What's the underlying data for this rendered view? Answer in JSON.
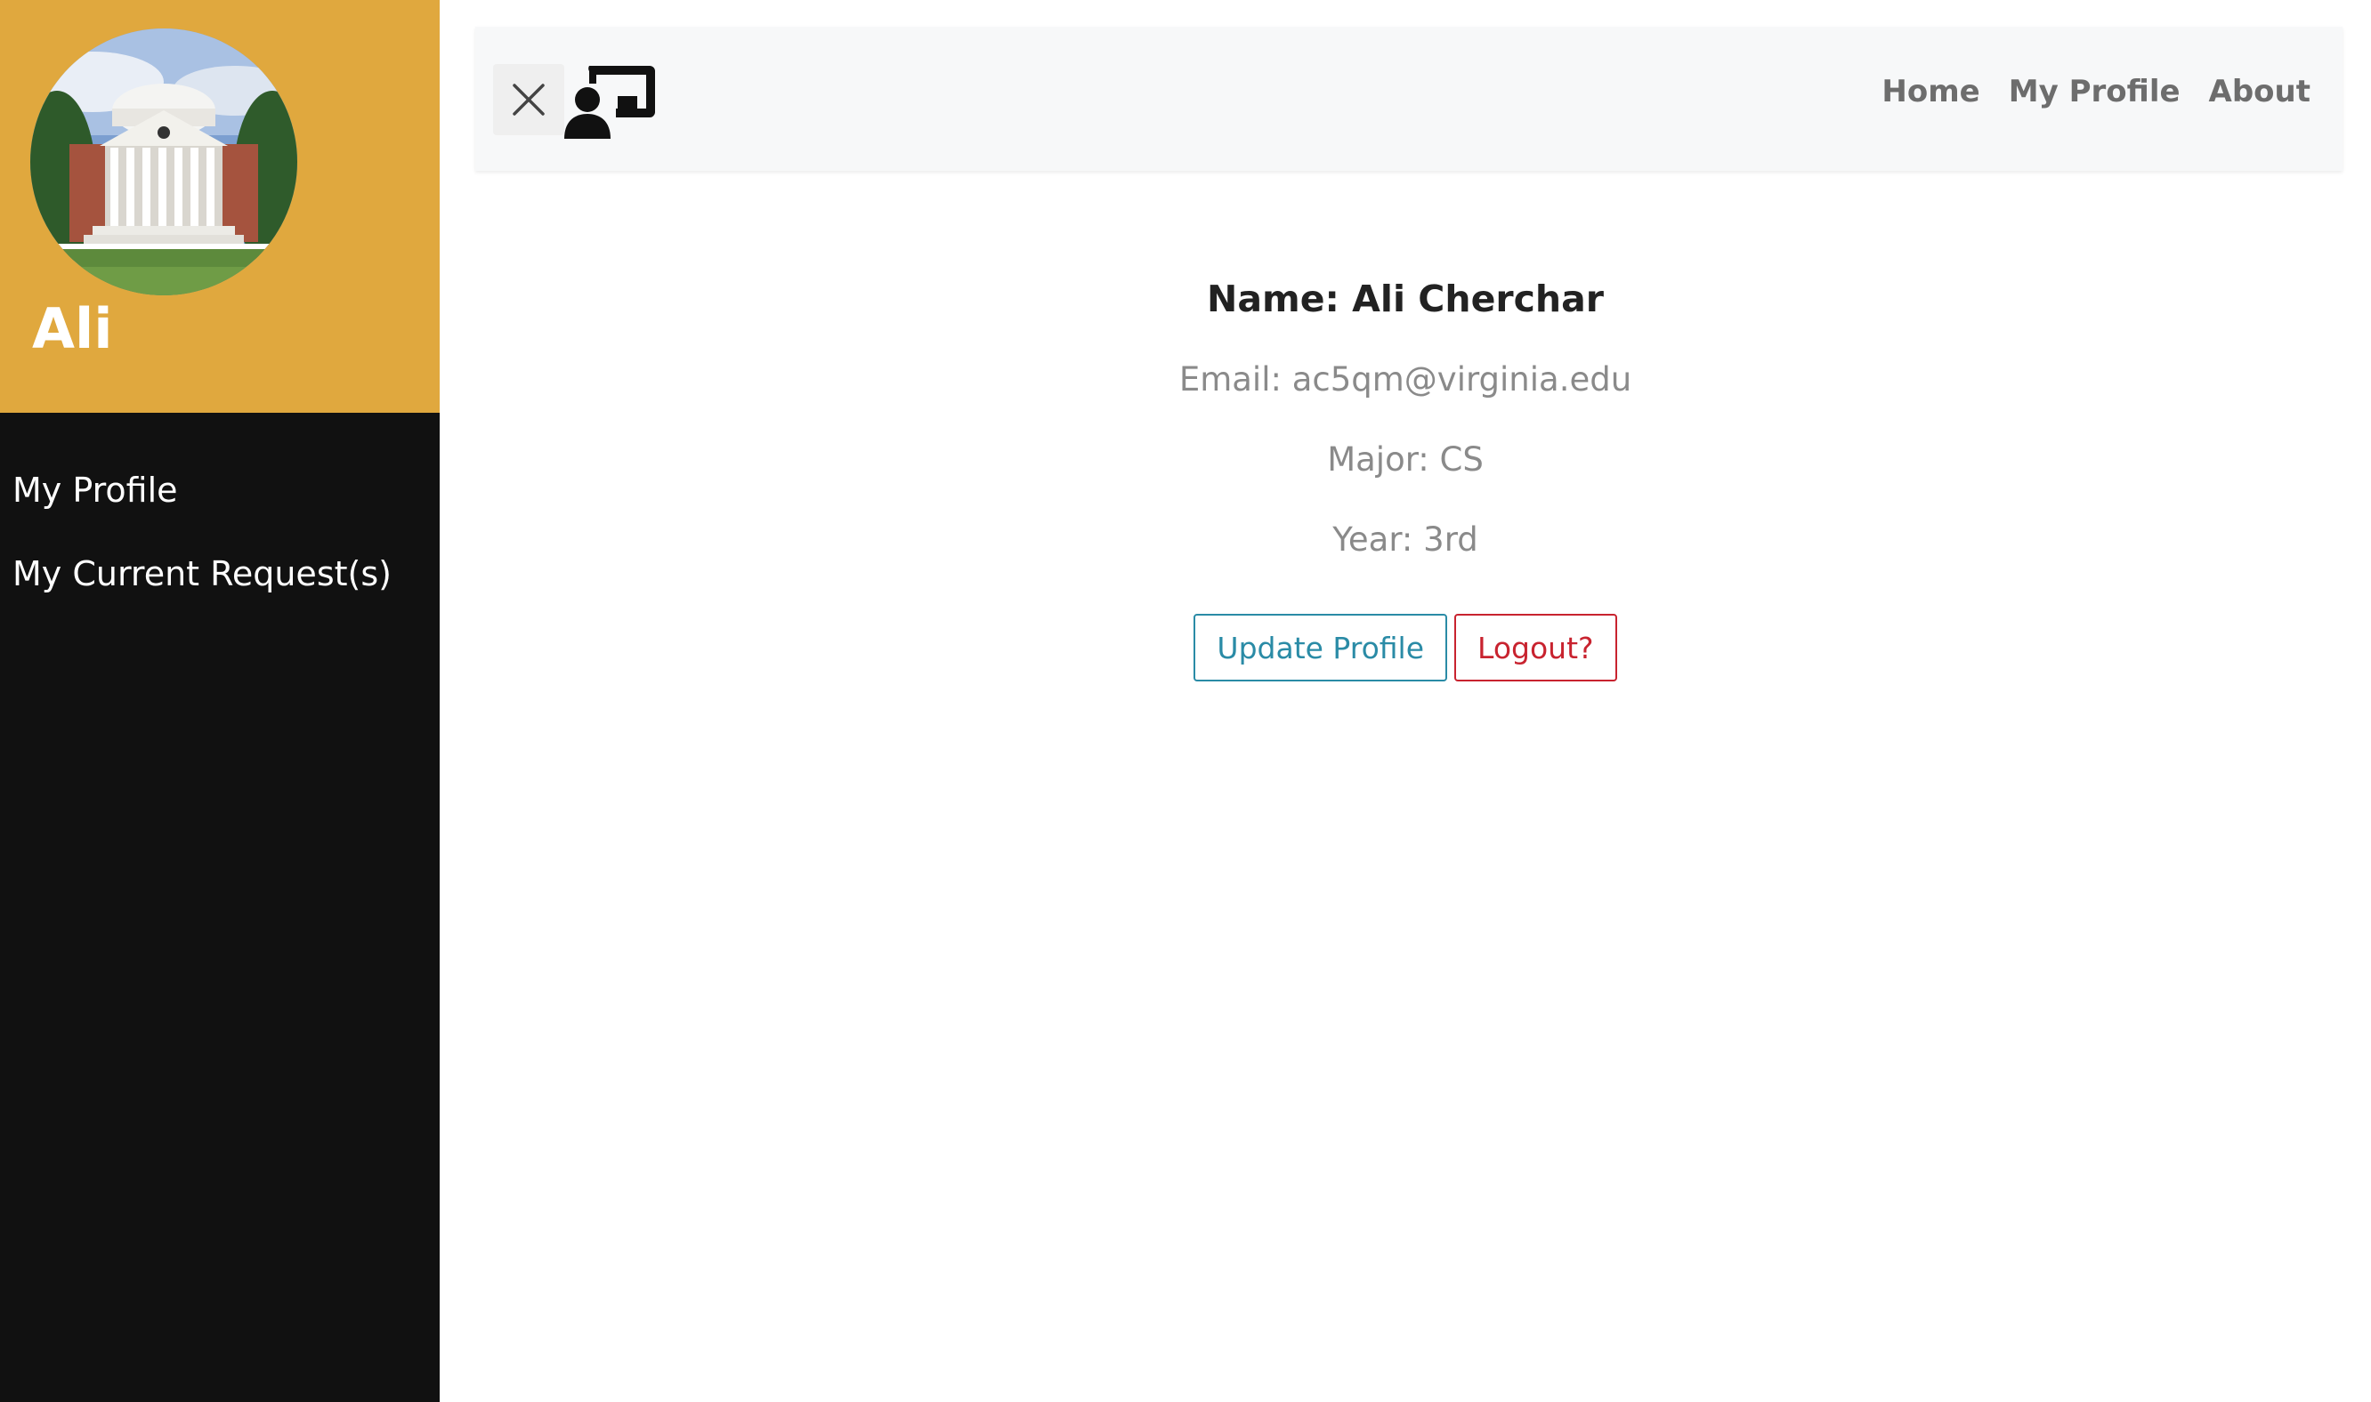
{
  "sidebar": {
    "username": "Ali",
    "avatar_image": "university-rotunda-photo",
    "items": [
      {
        "label": "My Profile"
      },
      {
        "label": "My Current Request(s)"
      }
    ]
  },
  "navbar": {
    "toggle_icon": "close-icon",
    "brand_icon": "person-presentation-icon",
    "links": [
      {
        "label": "Home"
      },
      {
        "label": "My Profile"
      },
      {
        "label": "About"
      }
    ]
  },
  "profile": {
    "name": "Name: Ali Cherchar",
    "email": "Email: ac5qm@virginia.edu",
    "major": "Major: CS",
    "year": "Year: 3rd",
    "update_label": "Update Profile",
    "logout_label": "Logout?"
  },
  "colors": {
    "sidebar_header": "#e0a83e",
    "sidebar_body": "#111111",
    "navbar_bg": "#f7f8f9",
    "info": "#2a8ba6",
    "danger": "#c8232f"
  }
}
